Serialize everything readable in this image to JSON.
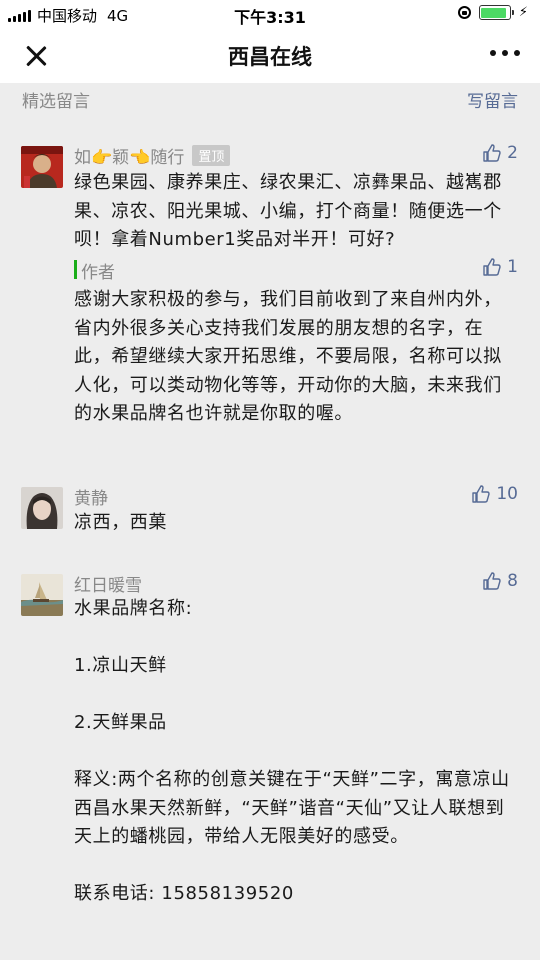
{
  "status_bar": {
    "carrier": "中国移动",
    "network": "4G",
    "time": "下午3:31",
    "battery_level": 0.9
  },
  "navbar": {
    "title": "西昌在线",
    "close_icon": "close-icon",
    "more_icon": "more-dots-icon"
  },
  "section": {
    "title": "精选留言",
    "write_label": "写留言"
  },
  "colors": {
    "link": "#576b95",
    "author_accent": "#1aad19",
    "background": "#ededed"
  },
  "comments": [
    {
      "nickname": "如👉颖👈随行",
      "pinned_label": "置顶",
      "likes": "2",
      "text": "绿色果园、康养果庄、绿农果汇、凉彝果品、越嶲郡果、凉农、阳光果城、小编，打个商量！随便选一个呗！拿着Number1奖品对半开！可好?",
      "reply": {
        "label": "作者",
        "likes": "1",
        "text": "感谢大家积极的参与，我们目前收到了来自州内外，省内外很多关心支持我们发展的朋友想的名字，在此，希望继续大家开拓思维，不要局限，名称可以拟人化，可以类动物化等等，开动你的大脑，未来我们的水果品牌名也许就是你取的喔。"
      }
    },
    {
      "nickname": "黄静",
      "likes": "10",
      "text": "凉西，西菓"
    },
    {
      "nickname": "红日暖雪",
      "likes": "8",
      "text": "水果品牌名称:\n\n1.凉山天鲜\n\n2.天鲜果品\n\n释义:两个名称的创意关键在于“天鲜”二字，寓意凉山西昌水果天然新鲜，“天鲜”谐音“天仙”又让人联想到天上的蟠桃园，带给人无限美好的感受。\n\n联系电话: 15858139520"
    }
  ]
}
